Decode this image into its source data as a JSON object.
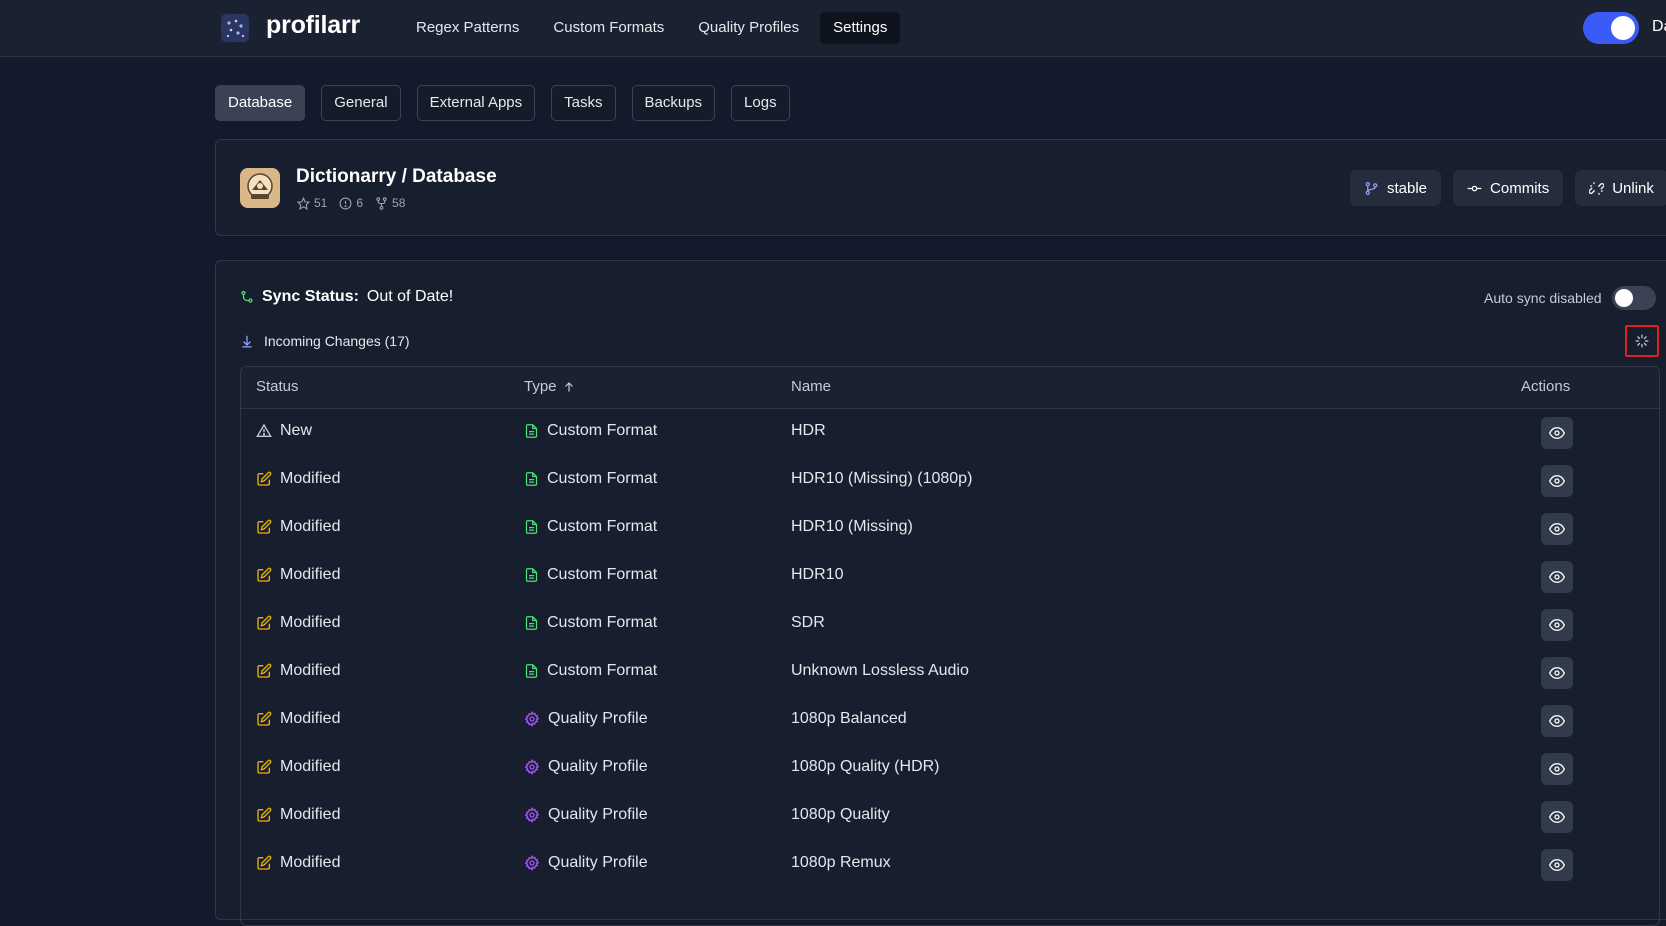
{
  "app": {
    "brand": "profilarr",
    "nav": [
      {
        "label": "Regex Patterns"
      },
      {
        "label": "Custom Formats"
      },
      {
        "label": "Quality Profiles"
      },
      {
        "label": "Settings",
        "active": true
      }
    ],
    "theme_toggle_label": "Da"
  },
  "settings_tabs": [
    {
      "label": "Database",
      "active": true
    },
    {
      "label": "General"
    },
    {
      "label": "External Apps"
    },
    {
      "label": "Tasks"
    },
    {
      "label": "Backups"
    },
    {
      "label": "Logs"
    }
  ],
  "repo": {
    "name": "Dictionarry / Database",
    "stars": "51",
    "issues": "6",
    "forks": "58",
    "branch_button": "stable",
    "commits_button": "Commits",
    "unlink_button": "Unlink"
  },
  "sync": {
    "status_label": "Sync Status:",
    "status_value": "Out of Date!",
    "auto_sync_label": "Auto sync disabled",
    "auto_sync_enabled": false,
    "incoming_label": "Incoming Changes (17)"
  },
  "table": {
    "headers": {
      "status": "Status",
      "type": "Type",
      "name": "Name",
      "actions": "Actions"
    },
    "sort_icon": "arrow-up-icon",
    "rows": [
      {
        "status": "New",
        "status_icon": "warning-triangle-icon",
        "type": "Custom Format",
        "type_icon": "file-icon",
        "name": "HDR"
      },
      {
        "status": "Modified",
        "status_icon": "edit-icon",
        "type": "Custom Format",
        "type_icon": "file-icon",
        "name": "HDR10 (Missing) (1080p)"
      },
      {
        "status": "Modified",
        "status_icon": "edit-icon",
        "type": "Custom Format",
        "type_icon": "file-icon",
        "name": "HDR10 (Missing)"
      },
      {
        "status": "Modified",
        "status_icon": "edit-icon",
        "type": "Custom Format",
        "type_icon": "file-icon",
        "name": "HDR10"
      },
      {
        "status": "Modified",
        "status_icon": "edit-icon",
        "type": "Custom Format",
        "type_icon": "file-icon",
        "name": "SDR"
      },
      {
        "status": "Modified",
        "status_icon": "edit-icon",
        "type": "Custom Format",
        "type_icon": "file-icon",
        "name": "Unknown Lossless Audio"
      },
      {
        "status": "Modified",
        "status_icon": "edit-icon",
        "type": "Quality Profile",
        "type_icon": "gear-icon",
        "name": "1080p Balanced"
      },
      {
        "status": "Modified",
        "status_icon": "edit-icon",
        "type": "Quality Profile",
        "type_icon": "gear-icon",
        "name": "1080p Quality (HDR)"
      },
      {
        "status": "Modified",
        "status_icon": "edit-icon",
        "type": "Quality Profile",
        "type_icon": "gear-icon",
        "name": "1080p Quality"
      },
      {
        "status": "Modified",
        "status_icon": "edit-icon",
        "type": "Quality Profile",
        "type_icon": "gear-icon",
        "name": "1080p Remux"
      }
    ]
  },
  "colors": {
    "background": "#131a2b",
    "accent": "#3b5bf6",
    "custom_format_icon": "#4ade80",
    "quality_profile_icon": "#a855f7",
    "modified_icon": "#eab308",
    "highlight_border": "#e11d25"
  }
}
